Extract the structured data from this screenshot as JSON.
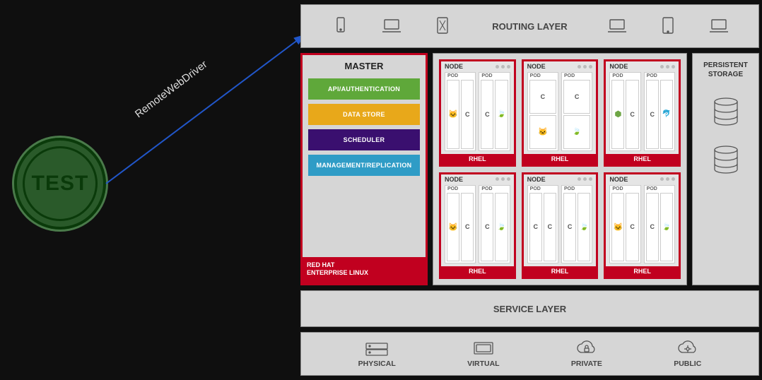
{
  "test_badge": {
    "label": "TEST"
  },
  "arrow_label": "RemoteWebDriver",
  "routing": {
    "title": "ROUTING LAYER"
  },
  "master": {
    "title": "MASTER",
    "api": "API/AUTHENTICATION",
    "data": "DATA STORE",
    "sched": "SCHEDULER",
    "mgmt": "MANAGEMENT/REPLICATION",
    "foot1": "RED HAT",
    "foot2": "ENTERPRISE LINUX"
  },
  "node_label": "NODE",
  "pod_label": "POD",
  "c_label": "C",
  "rhel": "RHEL",
  "storage": {
    "title1": "PERSISTENT",
    "title2": "STORAGE"
  },
  "service_layer": "SERVICE LAYER",
  "infra": {
    "physical": "PHYSICAL",
    "virtual": "VIRTUAL",
    "private": "PRIVATE",
    "public": "PUBLIC"
  }
}
